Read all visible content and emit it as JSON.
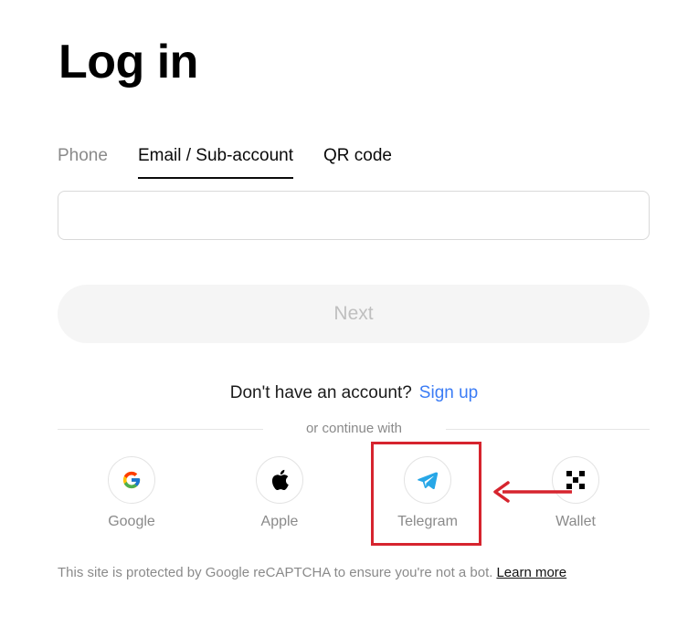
{
  "page": {
    "title": "Log in"
  },
  "tabs": [
    {
      "label": "Phone",
      "active": false
    },
    {
      "label": "Email / Sub-account",
      "active": true
    },
    {
      "label": "QR code",
      "active": false
    }
  ],
  "email_input": {
    "value": "",
    "placeholder": ""
  },
  "next_button": {
    "label": "Next",
    "disabled": true
  },
  "signup": {
    "question": "Don't have an account?",
    "link": "Sign up"
  },
  "divider": {
    "text": "or continue with"
  },
  "social": [
    {
      "label": "Google",
      "icon": "google-icon"
    },
    {
      "label": "Apple",
      "icon": "apple-icon"
    },
    {
      "label": "Telegram",
      "icon": "telegram-icon",
      "highlighted": true
    },
    {
      "label": "Wallet",
      "icon": "wallet-icon"
    }
  ],
  "recaptcha": {
    "text": "This site is protected by Google reCAPTCHA to ensure you're not a bot.",
    "link": "Learn more"
  },
  "colors": {
    "link_blue": "#3b7cf5",
    "highlight_red": "#d6242e",
    "next_bg": "#f5f5f5",
    "next_text": "#bfbfbf",
    "telegram_blue": "#27a7e7"
  }
}
